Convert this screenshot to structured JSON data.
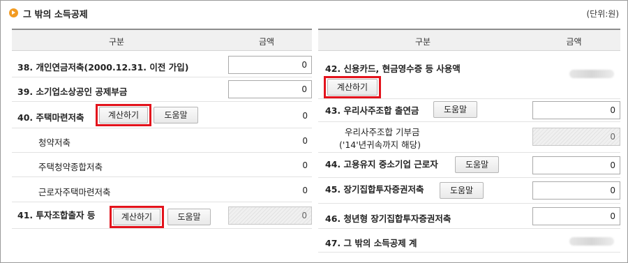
{
  "header": {
    "title": "그 밖의 소득공제",
    "unit": "(단위:원)"
  },
  "table": {
    "col_label": "구분",
    "col_amount": "금액"
  },
  "buttons": {
    "calc": "계산하기",
    "help": "도움말"
  },
  "left_rows": [
    {
      "label": "38. 개인연금저축(2000.12.31. 이전 가입)",
      "value": "0"
    },
    {
      "label": "39. 소기업소상공인 공제부금",
      "value": "0"
    },
    {
      "label": "40. 주택마련저축",
      "value": "0"
    },
    {
      "label": "청약저축",
      "value": "0"
    },
    {
      "label": "주택청약종합저축",
      "value": "0"
    },
    {
      "label": "근로자주택마련저축",
      "value": "0"
    },
    {
      "label": "41. 투자조합출자 등",
      "value": "0"
    }
  ],
  "right_rows": [
    {
      "label": "42. 신용카드, 현금영수증 등 사용액"
    },
    {
      "label": "43. 우리사주조합 출연금",
      "value": "0"
    },
    {
      "label_line1": "우리사주조합 기부금",
      "label_line2": "('14'년귀속까지 해당)",
      "value": "0"
    },
    {
      "label": "44. 고용유지 중소기업 근로자",
      "value": "0"
    },
    {
      "label": "45. 장기집합투자증권저축",
      "value": "0"
    },
    {
      "label": "46. 청년형 장기집합투자증권저축",
      "value": "0"
    },
    {
      "label": "47. 그 밖의 소득공제 계"
    }
  ]
}
